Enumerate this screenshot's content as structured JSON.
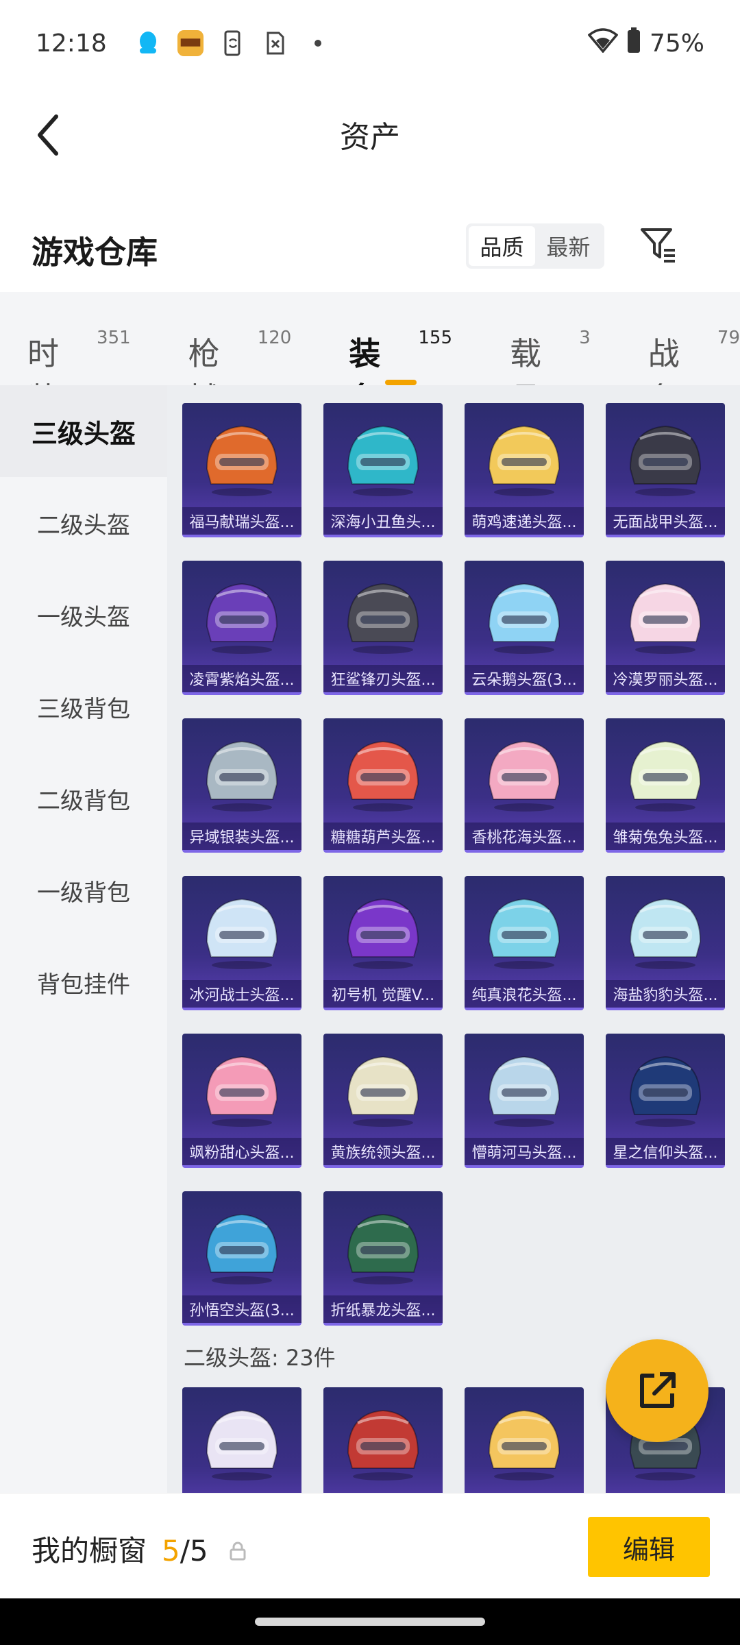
{
  "status_bar": {
    "time": "12:18",
    "battery": "75%",
    "icons": [
      "qq-icon",
      "game-app-icon",
      "phone-sync-icon",
      "sim-off-icon",
      "dot-icon",
      "wifi-icon",
      "battery-icon"
    ]
  },
  "header": {
    "title": "资产",
    "back_icon": "chevron-left-icon"
  },
  "warehouse": {
    "title": "游戏仓库",
    "sort_options": [
      "品质",
      "最新"
    ],
    "sort_selected": "品质",
    "filter_icon": "filter-icon"
  },
  "tabs": [
    {
      "label": "时装",
      "count": "351"
    },
    {
      "label": "枪械",
      "count": "120"
    },
    {
      "label": "装备",
      "count": "155",
      "active": true
    },
    {
      "label": "载具",
      "count": "3"
    },
    {
      "label": "战备",
      "count": "79"
    }
  ],
  "sidebar": {
    "items": [
      "三级头盔",
      "二级头盔",
      "一级头盔",
      "三级背包",
      "二级背包",
      "一级背包",
      "背包挂件"
    ],
    "active_index": 0
  },
  "items": [
    {
      "name": "福马献瑞头盔...",
      "color": "#e06a2c"
    },
    {
      "name": "深海小丑鱼头...",
      "color": "#2fb7c9"
    },
    {
      "name": "萌鸡速递头盔...",
      "color": "#f2c95a"
    },
    {
      "name": "无面战甲头盔...",
      "color": "#3a3a48"
    },
    {
      "name": "凌霄紫焰头盔...",
      "color": "#6a3fb8"
    },
    {
      "name": "狂鲨锋刃头盔...",
      "color": "#4a4a55"
    },
    {
      "name": "云朵鹅头盔(3...",
      "color": "#8fd3f4"
    },
    {
      "name": "冷漠罗丽头盔...",
      "color": "#f6d6e4"
    },
    {
      "name": "异域银装头盔...",
      "color": "#a9b8c3"
    },
    {
      "name": "糖糖葫芦头盔...",
      "color": "#e4574a"
    },
    {
      "name": "香桃花海头盔...",
      "color": "#f3a9c2"
    },
    {
      "name": "雏菊兔兔头盔...",
      "color": "#e6f1d0"
    },
    {
      "name": "冰河战士头盔...",
      "color": "#cfe4f6"
    },
    {
      "name": "初号机 觉醒V...",
      "color": "#7a37c9"
    },
    {
      "name": "纯真浪花头盔...",
      "color": "#7cd2e8"
    },
    {
      "name": "海盐豹豹头盔...",
      "color": "#bfe6f2"
    },
    {
      "name": "飒粉甜心头盔...",
      "color": "#f49bb7"
    },
    {
      "name": "黄族统领头盔...",
      "color": "#e7e2c6"
    },
    {
      "name": "懵萌河马头盔...",
      "color": "#b9d6ea"
    },
    {
      "name": "星之信仰头盔...",
      "color": "#1f3a78"
    },
    {
      "name": "孙悟空头盔(3...",
      "color": "#3fa3d9"
    },
    {
      "name": "折纸暴龙头盔...",
      "color": "#2e6b4d"
    }
  ],
  "section2": {
    "label": "二级头盔: 23件",
    "items": [
      {
        "color": "#e9e4f4"
      },
      {
        "color": "#c23a34"
      },
      {
        "color": "#f4c55e"
      },
      {
        "color": "#3a4a52"
      }
    ]
  },
  "fab": {
    "icon": "share-icon"
  },
  "bottom": {
    "label": "我的橱窗",
    "used": "5",
    "separator": "/",
    "total": "5",
    "lock_icon": "lock-icon",
    "edit_label": "编辑"
  },
  "colors": {
    "accent": "#f3a300",
    "button": "#ffc400",
    "card_top": "#2c2c6e",
    "card_bottom": "#5a3fb4"
  }
}
